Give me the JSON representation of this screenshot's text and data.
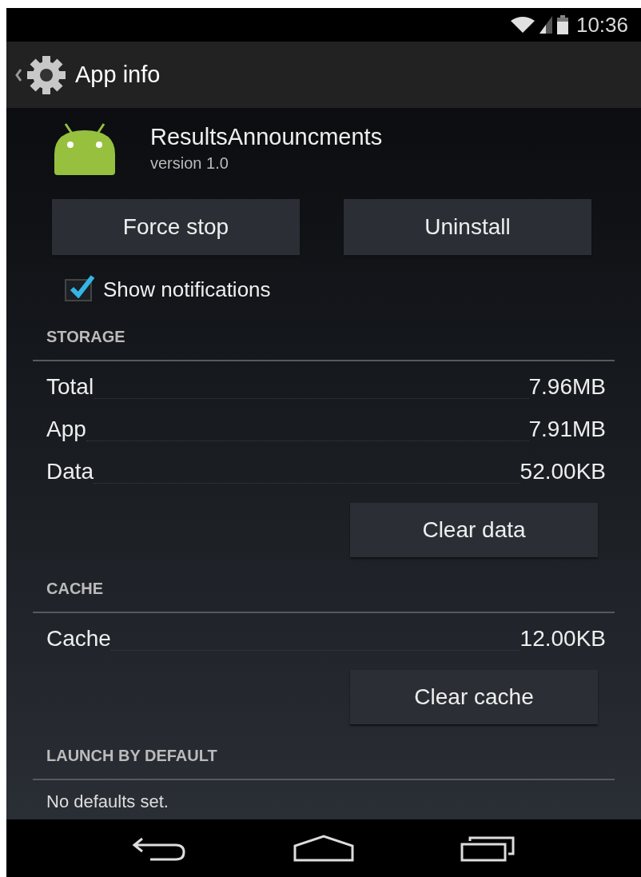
{
  "status_bar": {
    "time": "10:36"
  },
  "action_bar": {
    "title": "App info"
  },
  "app": {
    "name": "ResultsAnnouncments",
    "version": "version 1.0"
  },
  "buttons": [
    {
      "label": "Force stop"
    },
    {
      "label": "Uninstall"
    }
  ],
  "show_notifications": {
    "label": "Show notifications",
    "checked": true
  },
  "sections": [
    {
      "title": "STORAGE",
      "rows": [
        {
          "label": "Total",
          "value": "7.96MB"
        },
        {
          "label": "App",
          "value": "7.91MB"
        },
        {
          "label": "Data",
          "value": "52.00KB"
        }
      ],
      "button": "Clear data"
    },
    {
      "title": "CACHE",
      "rows": [
        {
          "label": "Cache",
          "value": "12.00KB"
        }
      ],
      "button": "Clear cache"
    },
    {
      "title": "LAUNCH BY DEFAULT",
      "note": "No defaults set."
    }
  ]
}
